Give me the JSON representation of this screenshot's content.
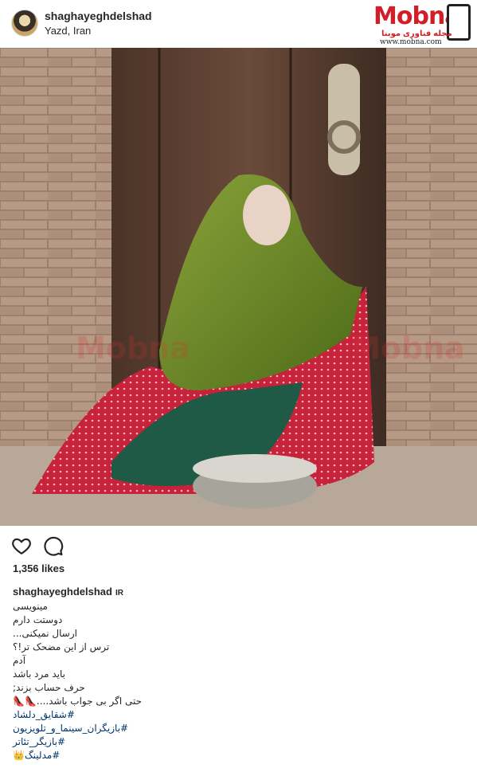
{
  "post": {
    "username": "shaghayeghdelshad",
    "location": "Yazd, Iran"
  },
  "brand": {
    "name": "Mobna",
    "tagline": "مجله فناوری موبنا",
    "url": "www.mobna.com",
    "accent": "#d01f28"
  },
  "image": {
    "watermark": "Mobna",
    "description_icon": "photo"
  },
  "actions": {
    "like_icon": "heart-icon",
    "comment_icon": "comment-icon"
  },
  "likes": "1,356 likes",
  "caption": {
    "username": "shaghayeghdelshad",
    "badge": "IR",
    "lines": [
      "مینویسی",
      "دوستت دارم",
      "ارسال نمیکنی...",
      "ترس از این مضحک تر!؟",
      "آدم",
      "باید مرد باشد",
      "حرف حساب بزند;",
      "حتی اگر بی جواب باشد....👠👠"
    ],
    "hashtags": [
      "#شقایق_دلشاد",
      "#بازیگران_سینما_و_تلویزیون",
      "#بازیگر_تئاتر",
      "#مدلینگ👑"
    ]
  }
}
